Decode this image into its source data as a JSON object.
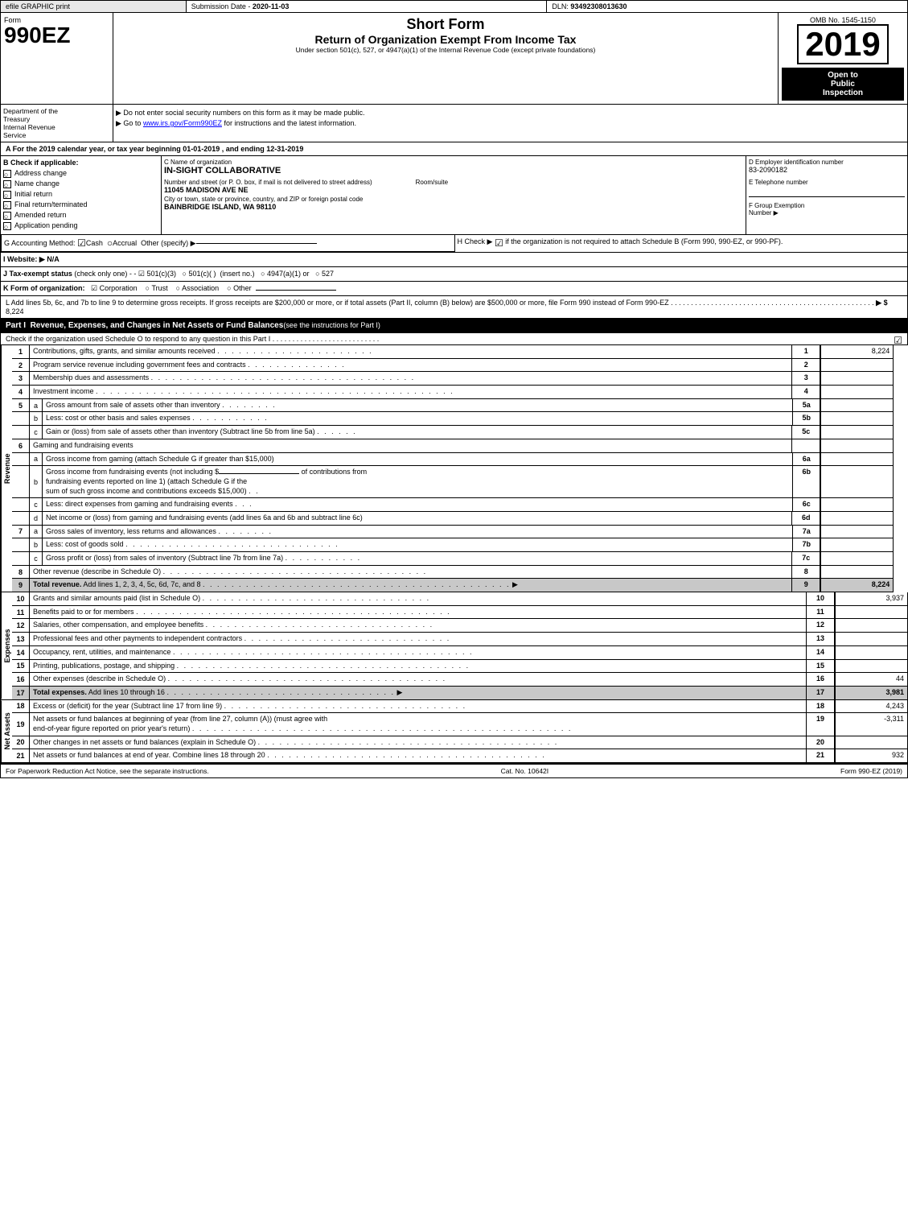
{
  "topbar": {
    "efile": "efile GRAPHIC print",
    "submission_label": "Submission Date -",
    "submission_date": "2020-11-03",
    "dln_label": "DLN:",
    "dln_number": "93492308013630"
  },
  "header": {
    "form_number": "990EZ",
    "form_label": "Form",
    "short_form": "Short Form",
    "return_title": "Return of Organization Exempt From Income Tax",
    "subtitle": "Under section 501(c), 527, or 4947(a)(1) of the Internal Revenue Code (except private foundations)",
    "instruction1": "▶ Do not enter social security numbers on this form as it may be made public.",
    "instruction2": "▶ Go to www.irs.gov/Form990EZ for instructions and the latest information.",
    "instruction2_url": "www.irs.gov/Form990EZ",
    "omb_label": "OMB No. 1545-1150",
    "year": "2019",
    "open_public": "Open to\nPublic\nInspection"
  },
  "dept": {
    "line1": "Department of the",
    "line2": "Treasury",
    "line3": "Internal Revenue",
    "line4": "Service"
  },
  "section_a": {
    "text": "A  For the 2019 calendar year, or tax year beginning 01-01-2019 , and ending 12-31-2019"
  },
  "section_b": {
    "label": "B  Check if applicable:",
    "items": [
      {
        "label": "Address change",
        "checked": false
      },
      {
        "label": "Name change",
        "checked": false
      },
      {
        "label": "Initial return",
        "checked": false
      },
      {
        "label": "Final return/terminated",
        "checked": false
      },
      {
        "label": "Amended return",
        "checked": false
      },
      {
        "label": "Application pending",
        "checked": false
      }
    ]
  },
  "section_c": {
    "label": "C  Name of organization",
    "org_name": "IN-SIGHT COLLABORATIVE",
    "address_label": "Number and street (or P. O. box, if mail is not delivered to street address)",
    "address": "11045 MADISON AVE NE",
    "room_label": "Room/suite",
    "room": "",
    "city_label": "City or town, state or province, country, and ZIP or foreign postal code",
    "city": "BAINBRIDGE ISLAND, WA  98110"
  },
  "section_d": {
    "label": "D  Employer identification number",
    "ein": "83-2090182",
    "phone_label": "E  Telephone number",
    "phone": "",
    "group_label": "F  Group Exemption",
    "group_sub": "Number",
    "group_number": ""
  },
  "section_g": {
    "label": "G  Accounting Method:",
    "cash_label": "Cash",
    "cash_checked": true,
    "accrual_label": "Accrual",
    "accrual_checked": false,
    "other_label": "Other (specify) ▶",
    "other_value": ""
  },
  "section_h": {
    "label": "H  Check ▶",
    "checkmark": "☑",
    "text": "if the organization is not required to attach Schedule B (Form 990, 990-EZ, or 990-PF)."
  },
  "section_i": {
    "label": "I  Website: ▶",
    "value": "N/A"
  },
  "section_j": {
    "label": "J  Tax-exempt status",
    "check_note": "(check only one) -",
    "option1": "501(c)(3)",
    "option1_checked": true,
    "option2": "501(c)(  )",
    "option2_checked": false,
    "option2_insert": "(insert no.)",
    "option3": "4947(a)(1) or",
    "option3_checked": false,
    "option4": "527",
    "option4_checked": false
  },
  "section_k": {
    "label": "K  Form of organization:",
    "corp_label": "Corporation",
    "corp_checked": true,
    "trust_label": "Trust",
    "trust_checked": false,
    "assoc_label": "Association",
    "assoc_checked": false,
    "other_label": "Other",
    "other_checked": false,
    "other_value": ""
  },
  "section_l": {
    "text": "L  Add lines 5b, 6c, and 7b to line 9 to determine gross receipts. If gross receipts are $200,000 or more, or if total assets (Part II, column (B) below) are $500,000 or more, file Form 990 instead of Form 990-EZ",
    "dots": ". . . . . . . . . . . . . . . . . . . . . . . . . . . . . . . . . . . . . . . . . . . . . . . . . . .",
    "arrow": "▶ $",
    "value": "8,224"
  },
  "part1": {
    "title": "Part I",
    "description": "Revenue, Expenses, and Changes in Net Assets or Fund Balances",
    "see_instructions": "(see the instructions for Part I)",
    "check_text": "Check if the organization used Schedule O to respond to any question in this Part I",
    "check_dots": ". . . . . . . . . . . . . . . . . . . . . . . . . . .",
    "check_box": "☑"
  },
  "revenue_rows": [
    {
      "num": "1",
      "sub": "",
      "description": "Contributions, gifts, grants, and similar amounts received",
      "dots": ". . . . . . . . . . . . . . . . . . . . . .",
      "line_ref": "1",
      "amount": "8,224"
    },
    {
      "num": "2",
      "sub": "",
      "description": "Program service revenue including government fees and contracts",
      "dots": ". . . . . . . . . . . . . . .",
      "line_ref": "2",
      "amount": ""
    },
    {
      "num": "3",
      "sub": "",
      "description": "Membership dues and assessments",
      "dots": ". . . . . . . . . . . . . . . . . . . . . . . . . . . . . . . . . . . . .",
      "line_ref": "3",
      "amount": ""
    },
    {
      "num": "4",
      "sub": "",
      "description": "Investment income",
      "dots": ". . . . . . . . . . . . . . . . . . . . . . . . . . . . . . . . . . . . . . . . . . . . . . . . . .",
      "line_ref": "4",
      "amount": ""
    },
    {
      "num": "5",
      "sub": "a",
      "description": "Gross amount from sale of assets other than inventory",
      "dots": ". . . . . . . .",
      "inline_ref": "5a",
      "amount_inline": ""
    },
    {
      "num": "",
      "sub": "b",
      "description": "Less: cost or other basis and sales expenses",
      "dots": ". . . . . . . . . . .",
      "inline_ref": "5b",
      "amount_inline": ""
    },
    {
      "num": "",
      "sub": "c",
      "description": "Gain or (loss) from sale of assets other than inventory (Subtract line 5b from line 5a)",
      "dots": ". . . . . .",
      "line_ref": "5c",
      "amount": ""
    },
    {
      "num": "6",
      "sub": "",
      "description": "Gaming and fundraising events"
    },
    {
      "num": "",
      "sub": "a",
      "description": "Gross income from gaming (attach Schedule G if greater than $15,000)",
      "inline_ref": "6a",
      "amount_inline": ""
    },
    {
      "num": "",
      "sub": "b",
      "description": "Gross income from fundraising events (not including $                      of contributions from fundraising events reported on line 1) (attach Schedule G if the sum of such gross income and contributions exceeds $15,000)",
      "dots": ". .",
      "inline_ref": "6b",
      "amount_inline": ""
    },
    {
      "num": "",
      "sub": "c",
      "description": "Less: direct expenses from gaming and fundraising events",
      "dots": ". . .",
      "inline_ref": "6c",
      "amount_inline": ""
    },
    {
      "num": "",
      "sub": "d",
      "description": "Net income or (loss) from gaming and fundraising events (add lines 6a and 6b and subtract line 6c)",
      "line_ref": "6d",
      "amount": ""
    },
    {
      "num": "7",
      "sub": "a",
      "description": "Gross sales of inventory, less returns and allowances",
      "dots": ". . . . . . . .",
      "inline_ref": "7a",
      "amount_inline": ""
    },
    {
      "num": "",
      "sub": "b",
      "description": "Less: cost of goods sold",
      "dots": ". . . . . . . . . . . . . . . . . . . . . . . . . . . . . .",
      "inline_ref": "7b",
      "amount_inline": ""
    },
    {
      "num": "",
      "sub": "c",
      "description": "Gross profit or (loss) from sales of inventory (Subtract line 7b from line 7a)",
      "dots": ". . . . . . . . . . .",
      "line_ref": "7c",
      "amount": ""
    },
    {
      "num": "8",
      "sub": "",
      "description": "Other revenue (describe in Schedule O)",
      "dots": ". . . . . . . . . . . . . . . . . . . . . . . . . . . . . . . . . . . . .",
      "line_ref": "8",
      "amount": ""
    },
    {
      "num": "9",
      "sub": "",
      "description": "Total revenue. Add lines 1, 2, 3, 4, 5c, 6d, 7c, and 8",
      "dots": ". . . . . . . . . . . . . . . . . . . . . . . . . . . . . . . . . . . . . . . . . . .",
      "arrow": "▶",
      "line_ref": "9",
      "amount": "8,224",
      "bold": true
    }
  ],
  "expenses_rows": [
    {
      "num": "10",
      "description": "Grants and similar amounts paid (list in Schedule O)",
      "dots": ". . . . . . . . . . . . . . . . . . . . . . . . . . . . . . . .",
      "line_ref": "10",
      "amount": "3,937"
    },
    {
      "num": "11",
      "description": "Benefits paid to or for members",
      "dots": ". . . . . . . . . . . . . . . . . . . . . . . . . . . . . . . . . . . . . . . . . . . .",
      "line_ref": "11",
      "amount": ""
    },
    {
      "num": "12",
      "description": "Salaries, other compensation, and employee benefits",
      "dots": ". . . . . . . . . . . . . . . . . . . . . . . . . . . . . . . .",
      "line_ref": "12",
      "amount": ""
    },
    {
      "num": "13",
      "description": "Professional fees and other payments to independent contractors",
      "dots": ". . . . . . . . . . . . . . . . . . . . . . . . . . . . .",
      "line_ref": "13",
      "amount": ""
    },
    {
      "num": "14",
      "description": "Occupancy, rent, utilities, and maintenance",
      "dots": ". . . . . . . . . . . . . . . . . . . . . . . . . . . . . . . . . . . . . . . . . .",
      "line_ref": "14",
      "amount": ""
    },
    {
      "num": "15",
      "description": "Printing, publications, postage, and shipping",
      "dots": ". . . . . . . . . . . . . . . . . . . . . . . . . . . . . . . . . . . . . . . . .",
      "line_ref": "15",
      "amount": ""
    },
    {
      "num": "16",
      "description": "Other expenses (describe in Schedule O)",
      "dots": ". . . . . . . . . . . . . . . . . . . . . . . . . . . . . . . . . . . . . . .",
      "line_ref": "16",
      "amount": "44"
    },
    {
      "num": "17",
      "description": "Total expenses. Add lines 10 through 16",
      "dots": ". . . . . . . . . . . . . . . . . . . . . . . . . . . . . . . .",
      "arrow": "▶",
      "line_ref": "17",
      "amount": "3,981",
      "bold": true
    }
  ],
  "net_assets_rows": [
    {
      "num": "18",
      "description": "Excess or (deficit) for the year (Subtract line 17 from line 9)",
      "dots": ". . . . . . . . . . . . . . . . . . . . . . . . . . . . . . . . . .",
      "line_ref": "18",
      "amount": "4,243"
    },
    {
      "num": "19",
      "description": "Net assets or fund balances at beginning of year (from line 27, column (A)) (must agree with end-of-year figure reported on prior year's return)",
      "dots": ". . . . . . . . . . . . . . . . . . . . . . . . . . . . . . . . . . . . . . . . . . . . . . . . . . . . . .",
      "line_ref": "19",
      "amount": "-3,311"
    },
    {
      "num": "20",
      "description": "Other changes in net assets or fund balances (explain in Schedule O)",
      "dots": ". . . . . . . . . . . . . . . . . . . . . . . . . . . . . . . . . . . . . . . . . .",
      "line_ref": "20",
      "amount": ""
    },
    {
      "num": "21",
      "description": "Net assets or fund balances at end of year. Combine lines 18 through 20",
      "dots": ". . . . . . . . . . . . . . . . . . . . . . . . . . . . . . . . . . . . . . .",
      "line_ref": "21",
      "amount": "932"
    }
  ],
  "footer": {
    "left": "For Paperwork Reduction Act Notice, see the separate instructions.",
    "cat": "Cat. No. 10642I",
    "right": "Form 990-EZ (2019)"
  }
}
